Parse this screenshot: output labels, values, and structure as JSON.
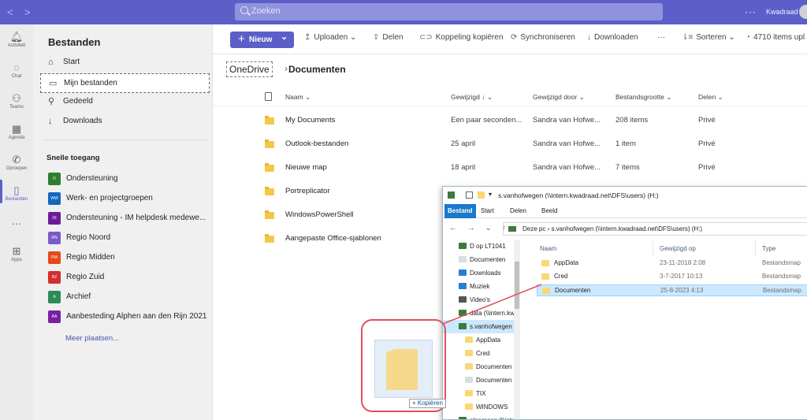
{
  "titlebar": {
    "search_placeholder": "Zoeken",
    "tenant": "Kwadraad"
  },
  "rail": [
    {
      "label": "Activiteit",
      "icon": "bell-icon"
    },
    {
      "label": "Chat",
      "icon": "chat-icon"
    },
    {
      "label": "Teams",
      "icon": "teams-icon"
    },
    {
      "label": "Agenda",
      "icon": "calendar-icon"
    },
    {
      "label": "Oproepen",
      "icon": "phone-icon"
    },
    {
      "label": "Bestanden",
      "icon": "file-icon"
    },
    {
      "label": "",
      "icon": "more-icon"
    },
    {
      "label": "Apps",
      "icon": "apps-icon"
    }
  ],
  "left": {
    "title": "Bestanden",
    "nav": [
      {
        "label": "Start",
        "icon": "home-icon"
      },
      {
        "label": "Mijn bestanden",
        "icon": "folder-icon"
      },
      {
        "label": "Gedeeld",
        "icon": "people-icon"
      },
      {
        "label": "Downloads",
        "icon": "download-icon"
      }
    ],
    "quick_title": "Snelle toegang",
    "quick": [
      {
        "label": "Ondersteuning",
        "badge": "O",
        "color": "#2e7d32"
      },
      {
        "label": "Werk- en projectgroepen",
        "badge": "WW",
        "color": "#1565c0"
      },
      {
        "label": "Ondersteuning - IM helpdesk medewe...",
        "badge": "OI",
        "color": "#6a1b9a"
      },
      {
        "label": "Regio Noord",
        "badge": "RN",
        "color": "#7b5ac9"
      },
      {
        "label": "Regio Midden",
        "badge": "RM",
        "color": "#e64a19"
      },
      {
        "label": "Regio Zuid",
        "badge": "RZ",
        "color": "#d32f2f"
      },
      {
        "label": "Archief",
        "badge": "A",
        "color": "#2e8b57"
      },
      {
        "label": "Aanbesteding Alphen aan den Rijn 2021",
        "badge": "AA",
        "color": "#7b1fa2"
      }
    ],
    "more": "Meer plaatsen..."
  },
  "toolbar": {
    "new": "Nieuw",
    "upload": "Uploaden",
    "share": "Delen",
    "copy_link": "Koppeling kopiëren",
    "sync": "Synchroniseren",
    "download": "Downloaden",
    "more": "···",
    "sort": "Sorteren",
    "count": "4710 items upl"
  },
  "breadcrumb": {
    "root": "OneDrive",
    "current": "Documenten"
  },
  "columns": {
    "name": "Naam",
    "modified": "Gewijzigd ↓",
    "modified_by": "Gewijzigd door",
    "size": "Bestandsgrootte",
    "share": "Delen"
  },
  "files": [
    {
      "name": "My Documents",
      "modified": "Een paar seconden...",
      "by": "Sandra van Hofwe...",
      "size": "208 items",
      "share": "Privé"
    },
    {
      "name": "Outlook-bestanden",
      "modified": "25 april",
      "by": "Sandra van Hofwe...",
      "size": "1 item",
      "share": "Privé"
    },
    {
      "name": "Nieuwe map",
      "modified": "18 april",
      "by": "Sandra van Hofwe...",
      "size": "7 items",
      "share": "Privé"
    },
    {
      "name": "Portreplicator",
      "modified": "",
      "by": "",
      "size": "",
      "share": ""
    },
    {
      "name": "WindowsPowerShell",
      "modified": "",
      "by": "",
      "size": "",
      "share": ""
    },
    {
      "name": "Aangepaste Office-sjablonen",
      "modified": "",
      "by": "",
      "size": "",
      "share": ""
    }
  ],
  "explorer": {
    "title": "s.vanhofwegen (\\\\intern.kwadraad.net\\DFS\\users) (H:)",
    "tabs": [
      "Bestand",
      "Start",
      "Delen",
      "Beeld"
    ],
    "path": "Deze pc  ›  s.vanhofwegen (\\\\intern.kwadraad.net\\DFS\\users) (H:)",
    "nav": [
      {
        "label": "D op LT1041",
        "color": "#3d7a3d"
      },
      {
        "label": "Documenten",
        "color": "#d8dde6"
      },
      {
        "label": "Downloads",
        "color": "#2b7cd3"
      },
      {
        "label": "Muziek",
        "color": "#2b7cd3"
      },
      {
        "label": "Video's",
        "color": "#555555"
      },
      {
        "label": "data (\\\\intern.kw",
        "color": "#3d7a3d"
      },
      {
        "label": "s.vanhofwegen (",
        "color": "#3d7a3d"
      },
      {
        "label": "AppData",
        "color": "#f8d775"
      },
      {
        "label": "Cred",
        "color": "#f8d775"
      },
      {
        "label": "Documenten",
        "color": "#f8d775"
      },
      {
        "label": "Documenten",
        "color": "#d8dde6"
      },
      {
        "label": "TIX",
        "color": "#f8d775"
      },
      {
        "label": "WINDOWS",
        "color": "#f8d775"
      },
      {
        "label": "algemeen (\\\\intr",
        "color": "#3d7a3d"
      }
    ],
    "columns": {
      "name": "Naam",
      "modified": "Gewijzigd op",
      "type": "Type"
    },
    "rows": [
      {
        "name": "AppData",
        "modified": "23-11-2018 2:08",
        "type": "Bestandsmap"
      },
      {
        "name": "Cred",
        "modified": "3-7-2017 10:13",
        "type": "Bestandsmap"
      },
      {
        "name": "Documenten",
        "modified": "25-8-2023 4:13",
        "type": "Bestandsmap"
      }
    ]
  },
  "drag": {
    "label": "+ Kopiëren"
  }
}
